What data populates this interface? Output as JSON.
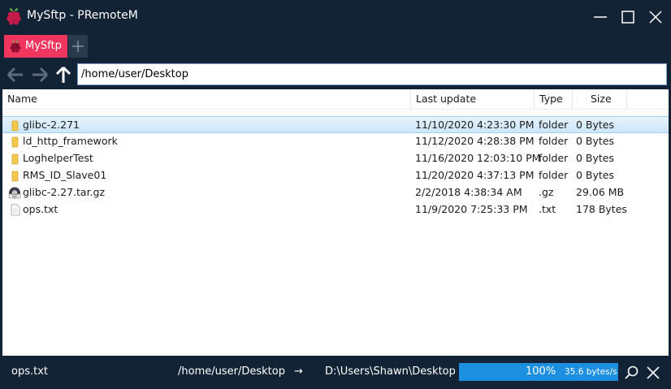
{
  "window": {
    "title": "MySftp - PRemoteM"
  },
  "tabs": [
    {
      "label": "MySftp",
      "active": true
    }
  ],
  "nav": {
    "path": "/home/user/Desktop"
  },
  "file_list": {
    "columns": [
      "Name",
      "Last update",
      "Type",
      "Size"
    ],
    "rows": [
      {
        "name": "glibc-2.271",
        "last_update": "11/10/2020 4:23:30 PM",
        "type": "folder",
        "size": "0 Bytes",
        "icon": "folder-icon",
        "selected": true
      },
      {
        "name": "ld_http_framework",
        "last_update": "11/12/2020 4:28:38 PM",
        "type": "folder",
        "size": "0 Bytes",
        "icon": "folder-icon",
        "selected": false
      },
      {
        "name": "LoghelperTest",
        "last_update": "11/16/2020 12:03:10 PM",
        "type": "folder",
        "size": "0 Bytes",
        "icon": "folder-icon",
        "selected": false
      },
      {
        "name": "RMS_ID_Slave01",
        "last_update": "11/20/2020 4:37:13 PM",
        "type": "folder",
        "size": "0 Bytes",
        "icon": "folder-icon",
        "selected": false
      },
      {
        "name": "glibc-2.27.tar.gz",
        "last_update": "2/2/2018 4:38:34 AM",
        "type": ".gz",
        "size": "29.06 MB",
        "icon": "archive-icon",
        "selected": false
      },
      {
        "name": "ops.txt",
        "last_update": "11/9/2020 7:25:33 PM",
        "type": ".txt",
        "size": "178 Bytes",
        "icon": "text-file-icon",
        "selected": false
      }
    ]
  },
  "status": {
    "file": "ops.txt",
    "remote_path": "/home/user/Desktop",
    "arrow": "→",
    "local_path": "D:\\Users\\Shawn\\Desktop",
    "progress_percent": 100,
    "progress_label": "100%",
    "speed": "35.6 bytes/s"
  },
  "colors": {
    "background": "#122336",
    "tab_active": "#f0365e",
    "progress_fill": "#1d8fe0",
    "selected_row": "#cbe6f9",
    "folder": "#f2c94c"
  }
}
